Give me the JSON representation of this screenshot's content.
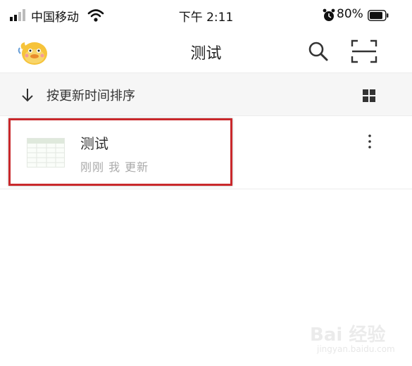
{
  "status_bar": {
    "carrier": "中国移动",
    "time": "下午 2:11",
    "battery": "80%",
    "icons": [
      "signal-icon",
      "wifi-icon",
      "alarm-icon",
      "battery-icon"
    ]
  },
  "nav": {
    "title": "测试",
    "icons": [
      "avatar",
      "search-icon",
      "scan-icon"
    ]
  },
  "sort": {
    "label": "按更新时间排序",
    "icons": [
      "sort-arrow-down-icon",
      "grid-view-icon"
    ]
  },
  "files": [
    {
      "name": "测试",
      "meta": "刚刚 我 更新",
      "icon": "spreadsheet-thumbnail-icon",
      "highlighted": true
    }
  ],
  "watermark": {
    "logo": "Bai 经验",
    "sub": "jingyan.baidu.com"
  },
  "colors": {
    "highlight_border": "#c9282b",
    "sort_bar_bg": "#f6f6f6",
    "meta_text": "#aaaaaa"
  }
}
